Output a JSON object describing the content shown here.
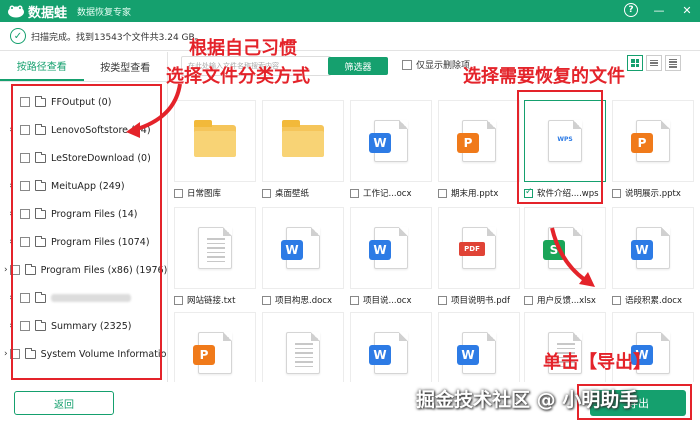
{
  "titlebar": {
    "app_name": "数据蛙",
    "subtitle": "数据恢复专家",
    "help": "?",
    "minimize": "—",
    "close": "✕"
  },
  "status": {
    "check": "✓",
    "text": "扫描完成。找到13543个文件共3.24 GB。"
  },
  "tabs": {
    "by_path": "按路径查看",
    "by_type": "按类型查看"
  },
  "tree": [
    {
      "label": "FFOutput (0)",
      "arrow": ""
    },
    {
      "label": "LenovoSoftstore (14)",
      "arrow": "›"
    },
    {
      "label": "LeStoreDownload (0)",
      "arrow": ""
    },
    {
      "label": "MeituApp (249)",
      "arrow": "›"
    },
    {
      "label": "Program Files (14)",
      "arrow": "›"
    },
    {
      "label": "Program Files (1074)",
      "arrow": "›"
    },
    {
      "label": "Program Files (x86) (1976)",
      "arrow": "›"
    },
    {
      "label": "",
      "arrow": "›"
    },
    {
      "label": "Summary (2325)",
      "arrow": "›"
    },
    {
      "label": "System Volume Information",
      "arrow": "›"
    }
  ],
  "toolbar": {
    "search_placeholder": "在此处输入文件名称搜索内容",
    "filter": "筛选器",
    "only_deleted": "仅显示删除项"
  },
  "files": [
    {
      "name": "日常图库",
      "type": "folder"
    },
    {
      "name": "桌面壁纸",
      "type": "folder"
    },
    {
      "name": "工作记...ocx",
      "type": "w"
    },
    {
      "name": "期末用.pptx",
      "type": "p"
    },
    {
      "name": "软件介绍....wps",
      "type": "wps",
      "selected": true
    },
    {
      "name": "说明展示.pptx",
      "type": "p"
    },
    {
      "name": "网站链接.txt",
      "type": "txt"
    },
    {
      "name": "项目构思.docx",
      "type": "w"
    },
    {
      "name": "项目说...ocx",
      "type": "w"
    },
    {
      "name": "项目说明书.pdf",
      "type": "pdf"
    },
    {
      "name": "用户反馈...xlsx",
      "type": "s"
    },
    {
      "name": "语段积累.docx",
      "type": "w"
    },
    {
      "name": "",
      "type": "p"
    },
    {
      "name": "",
      "type": "txt"
    },
    {
      "name": "",
      "type": "w"
    },
    {
      "name": "",
      "type": "w"
    },
    {
      "name": "",
      "type": "txt"
    },
    {
      "name": "",
      "type": "w"
    }
  ],
  "icon_glyphs": {
    "w": "W",
    "p": "P",
    "s": "S",
    "pdf": "PDF",
    "wps": "WPS"
  },
  "buttons": {
    "back": "返回",
    "export": "导出"
  },
  "annotations": {
    "left_1": "根据自己习惯",
    "left_2": "选择文件分类方式",
    "right": "选择需要恢复的文件",
    "export": "单击【导出】"
  },
  "watermark": "掘金技术社区 @ 小明助手",
  "colors": {
    "brand": "#15a06e",
    "annotation": "#e4232a"
  }
}
